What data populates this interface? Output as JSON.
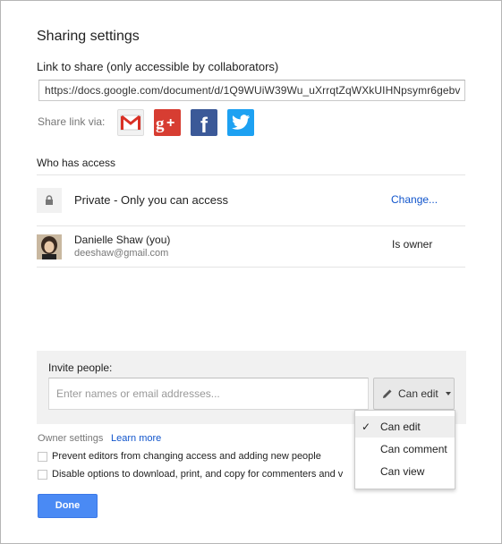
{
  "dialog": {
    "title": "Sharing settings",
    "link_label": "Link to share (only accessible by collaborators)",
    "link_url": "https://docs.google.com/document/d/1Q9WUiW39Wu_uXrrqtZqWXkUIHNpsymr6gebv",
    "share_via_label": "Share link via:",
    "share_services": [
      "gmail-icon",
      "google-plus-icon",
      "facebook-icon",
      "twitter-icon"
    ],
    "who_has_access": "Who has access",
    "access": {
      "private_text": "Private - Only you can access",
      "change_link": "Change...",
      "user_name": "Danielle Shaw (you)",
      "user_email": "deeshaw@gmail.com",
      "user_role": "Is owner"
    },
    "invite": {
      "label": "Invite people:",
      "placeholder": "Enter names or email addresses...",
      "permission": "Can edit",
      "menu": [
        "Can edit",
        "Can comment",
        "Can view"
      ],
      "selected": "Can edit"
    },
    "owner_settings": {
      "label": "Owner settings",
      "learn_more": "Learn more",
      "option1": "Prevent editors from changing access and adding new people",
      "option2": "Disable options to download, print, and copy for commenters and v"
    },
    "done_label": "Done"
  },
  "colors": {
    "accent_blue": "#4a8af4",
    "link_blue": "#1155cc",
    "panel_gray": "#f1f1f1"
  }
}
